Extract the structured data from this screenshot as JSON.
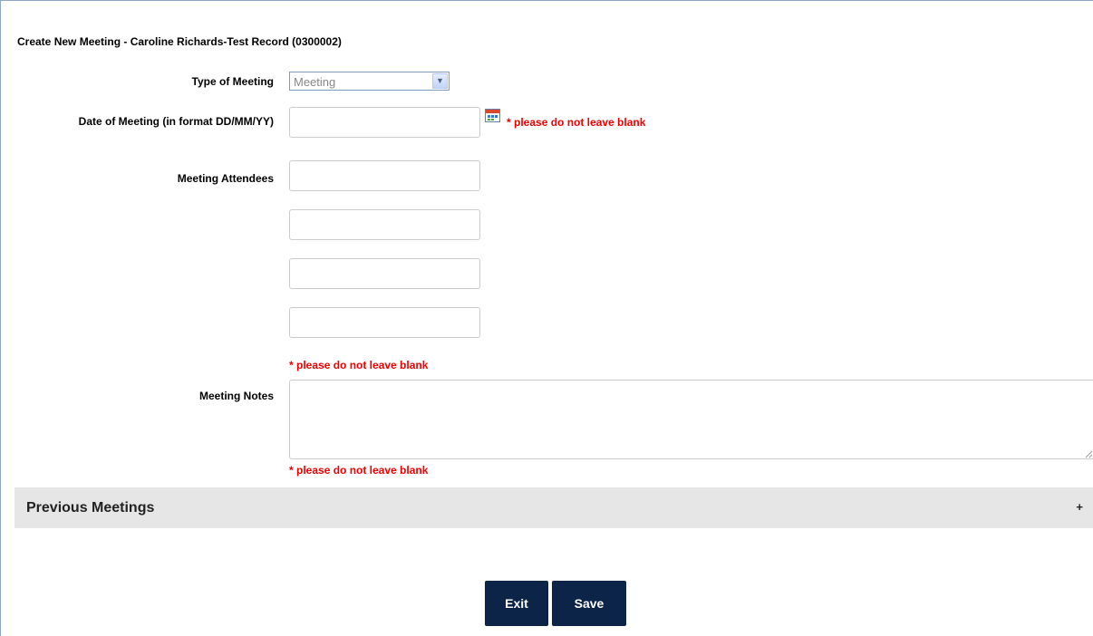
{
  "page": {
    "title": "Create New Meeting - Caroline Richards-Test Record (0300002)"
  },
  "form": {
    "type_of_meeting": {
      "label": "Type of Meeting",
      "value": "Meeting"
    },
    "date_of_meeting": {
      "label": "Date of Meeting (in format DD/MM/YY)",
      "value": "",
      "error": "* please do not leave blank"
    },
    "attendees": {
      "label": "Meeting Attendees",
      "values": [
        "",
        "",
        "",
        ""
      ],
      "error": "* please do not leave blank"
    },
    "notes": {
      "label": "Meeting Notes",
      "value": "",
      "error": "* please do not leave blank"
    }
  },
  "previous_meetings": {
    "title": "Previous Meetings",
    "toggle": "+"
  },
  "buttons": {
    "exit": "Exit",
    "save": "Save"
  },
  "colors": {
    "error": "#ee0000",
    "button_bg": "#0b2447",
    "section_bg": "#e6e6e6"
  },
  "icons": {
    "calendar": "calendar-icon",
    "dropdown": "chevron-down-icon"
  }
}
